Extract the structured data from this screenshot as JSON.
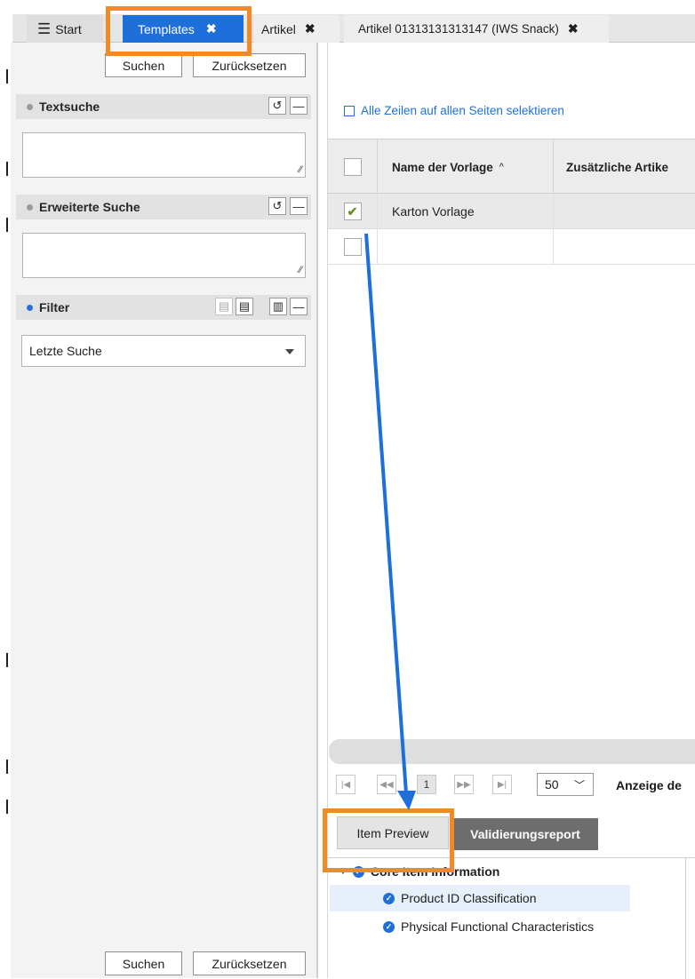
{
  "tabs": {
    "start": "Start",
    "templates": "Templates",
    "artikel": "Artikel",
    "artikel_iws": "Artikel 01313131313147 (IWS Snack)"
  },
  "left": {
    "search_top": "Suchen",
    "reset_top": "Zurücksetzen",
    "textsuche": "Textsuche",
    "erweiterte": "Erweiterte Suche",
    "filter": "Filter",
    "filter_select_value": "Letzte Suche",
    "search_bottom": "Suchen",
    "reset_bottom": "Zurücksetzen"
  },
  "grid": {
    "select_all": "Alle Zeilen auf allen Seiten selektieren",
    "col_name": "Name der Vorlage",
    "col_name_sort": "^",
    "col_extra": "Zusätzliche Artike",
    "rows": [
      {
        "name": "Karton Vorlage",
        "checked": true
      },
      {
        "name": "",
        "checked": false
      }
    ]
  },
  "pager": {
    "first": "|◀",
    "prev": "◀◀",
    "page": "1",
    "next": "▶▶",
    "last": "▶|",
    "page_size": "50",
    "showing": "Anzeige de"
  },
  "preview": {
    "tab_preview": "Item Preview",
    "tab_validation": "Validierungsreport",
    "tree": {
      "root": "Core Item Information",
      "children": [
        "Product ID Classification",
        "Physical Functional Characteristics"
      ]
    }
  },
  "colors": {
    "accent": "#1e6fd9",
    "highlight_box": "#f08a24",
    "validation_tab": "#6d6d6d"
  }
}
